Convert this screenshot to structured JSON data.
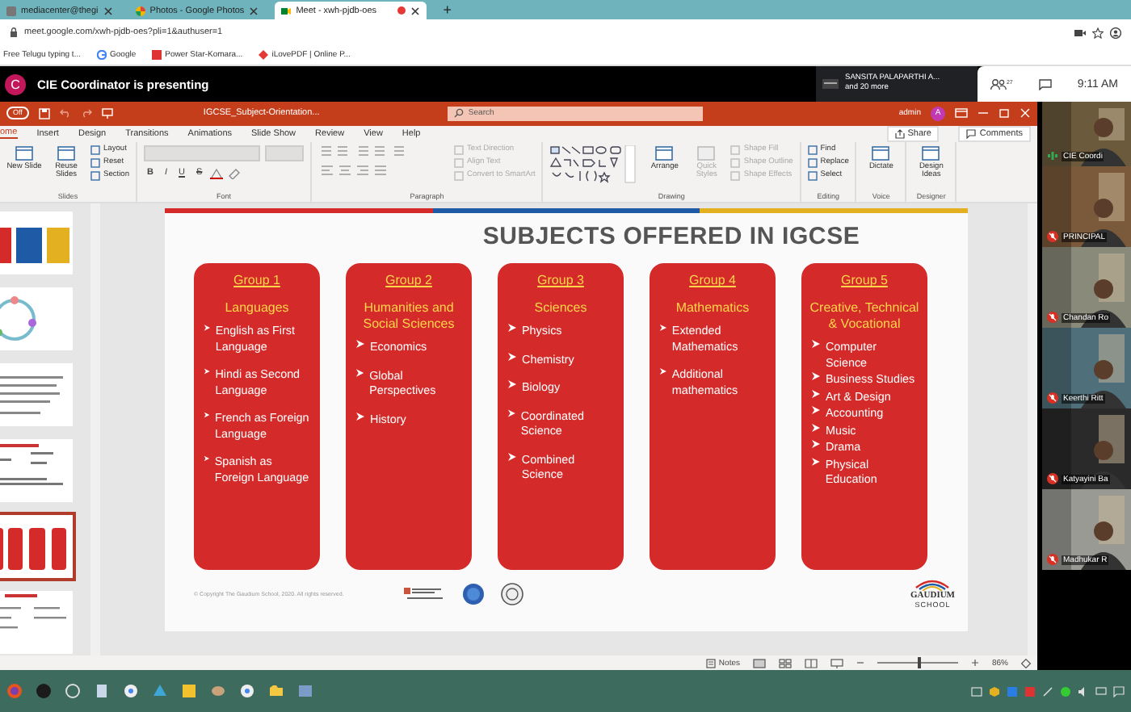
{
  "browser": {
    "tabs": [
      {
        "label": "mediacenter@thegi",
        "selected": false,
        "recording": false
      },
      {
        "label": "Photos - Google Photos",
        "selected": false,
        "recording": false
      },
      {
        "label": "Meet - xwh-pjdb-oes",
        "selected": true,
        "recording": true
      }
    ],
    "new_tab": "+",
    "address": "meet.google.com/xwh-pjdb-oes?pli=1&authuser=1",
    "bookmarks": [
      "Free Telugu typing t...",
      "Google",
      "Power Star-Komara...",
      "iLovePDF | Online P..."
    ]
  },
  "meet": {
    "avatar_letter": "C",
    "banner": "CIE Coordinator is presenting",
    "presenter": "SANSITA PALAPARTHI A...",
    "more": "and 20 more",
    "people_count": "27",
    "time": "9:11 AM"
  },
  "powerpoint": {
    "autosave": "Off",
    "file_name": "IGCSE_Subject-Orientation...",
    "search_placeholder": "Search",
    "user": "admin",
    "user_initial": "A",
    "tabs": [
      {
        "label": "ome",
        "selected": true
      },
      {
        "label": "Insert",
        "selected": false
      },
      {
        "label": "Design",
        "selected": false
      },
      {
        "label": "Transitions",
        "selected": false
      },
      {
        "label": "Animations",
        "selected": false
      },
      {
        "label": "Slide Show",
        "selected": false
      },
      {
        "label": "Review",
        "selected": false
      },
      {
        "label": "View",
        "selected": false
      },
      {
        "label": "Help",
        "selected": false
      }
    ],
    "share": "Share",
    "comments": "Comments",
    "ribbon": [
      {
        "name": "Slides",
        "kind": "plain",
        "large": [
          {
            "label": "New Slide",
            "disabled": false
          },
          {
            "label": "Reuse Slides",
            "disabled": false
          }
        ],
        "small": [
          {
            "label": "Layout",
            "disabled": false
          },
          {
            "label": "Reset",
            "disabled": false
          },
          {
            "label": "Section",
            "disabled": false
          }
        ]
      },
      {
        "name": "Font",
        "kind": "font",
        "tools": [
          "B",
          "I",
          "U",
          "S"
        ]
      },
      {
        "name": "Paragraph",
        "kind": "paragraph",
        "small": [
          {
            "label": "Text Direction",
            "disabled": true
          },
          {
            "label": "Align Text",
            "disabled": true
          },
          {
            "label": "Convert to SmartArt",
            "disabled": true
          }
        ]
      },
      {
        "name": "Drawing",
        "kind": "drawing",
        "large": [
          {
            "label": "Arrange",
            "disabled": false
          },
          {
            "label": "Quick Styles",
            "disabled": true
          }
        ],
        "small": [
          {
            "label": "Shape Fill",
            "disabled": true
          },
          {
            "label": "Shape Outline",
            "disabled": true
          },
          {
            "label": "Shape Effects",
            "disabled": true
          }
        ]
      },
      {
        "name": "Editing",
        "kind": "plain",
        "small": [
          {
            "label": "Find",
            "disabled": false
          },
          {
            "label": "Replace",
            "disabled": false
          },
          {
            "label": "Select",
            "disabled": false
          }
        ]
      },
      {
        "name": "Voice",
        "kind": "plain",
        "large": [
          {
            "label": "Dictate",
            "disabled": false
          }
        ]
      },
      {
        "name": "Designer",
        "kind": "plain",
        "large": [
          {
            "label": "Design Ideas",
            "disabled": false
          }
        ]
      }
    ]
  },
  "thumbnails": [
    {
      "kind": "boxes",
      "selected": false
    },
    {
      "kind": "cycle",
      "selected": false
    },
    {
      "kind": "text",
      "selected": false
    },
    {
      "kind": "diagram",
      "selected": false
    },
    {
      "kind": "cards",
      "selected": true
    },
    {
      "kind": "table",
      "selected": false
    }
  ],
  "slide": {
    "title": "SUBJECTS OFFERED IN IGCSE",
    "groups": [
      {
        "group": "Group 1",
        "heading": "Languages",
        "items": [
          "English as First Language",
          "Hindi as Second Language",
          "French as Foreign Language",
          "Spanish as Foreign Language"
        ]
      },
      {
        "group": "Group 2",
        "heading": "Humanities and Social Sciences",
        "items": [
          "Economics",
          "Global Perspectives",
          "History"
        ]
      },
      {
        "group": "Group 3",
        "heading": "Sciences",
        "items": [
          "Physics",
          "Chemistry",
          "Biology",
          "Coordinated Science",
          "Combined Science"
        ]
      },
      {
        "group": "Group 4",
        "heading": "Mathematics",
        "items": [
          "Extended Mathematics",
          "Additional mathematics"
        ]
      },
      {
        "group": "Group 5",
        "heading": "Creative, Technical & Vocational",
        "items": [
          "Computer Science",
          "Business Studies",
          "Art & Design",
          "Accounting",
          "Music",
          "Drama",
          "Physical Education"
        ]
      }
    ],
    "copyright": "© Copyright The Gaudium School, 2020. All rights reserved.",
    "logo_name": "GAUDIUM",
    "logo_sub": "SCHOOL"
  },
  "status_bar": {
    "notes": "Notes",
    "zoom": "86%",
    "zoom_slider": {
      "level": 0.5
    }
  },
  "participants": [
    {
      "name": "CIE Coordi",
      "muted": false
    },
    {
      "name": "PRINCIPAL",
      "muted": true
    },
    {
      "name": "Chandan Ro",
      "muted": true
    },
    {
      "name": "Keerthi Ritt",
      "muted": true
    },
    {
      "name": "Katyayini Ba",
      "muted": true
    },
    {
      "name": "Madhukar R",
      "muted": true
    }
  ]
}
